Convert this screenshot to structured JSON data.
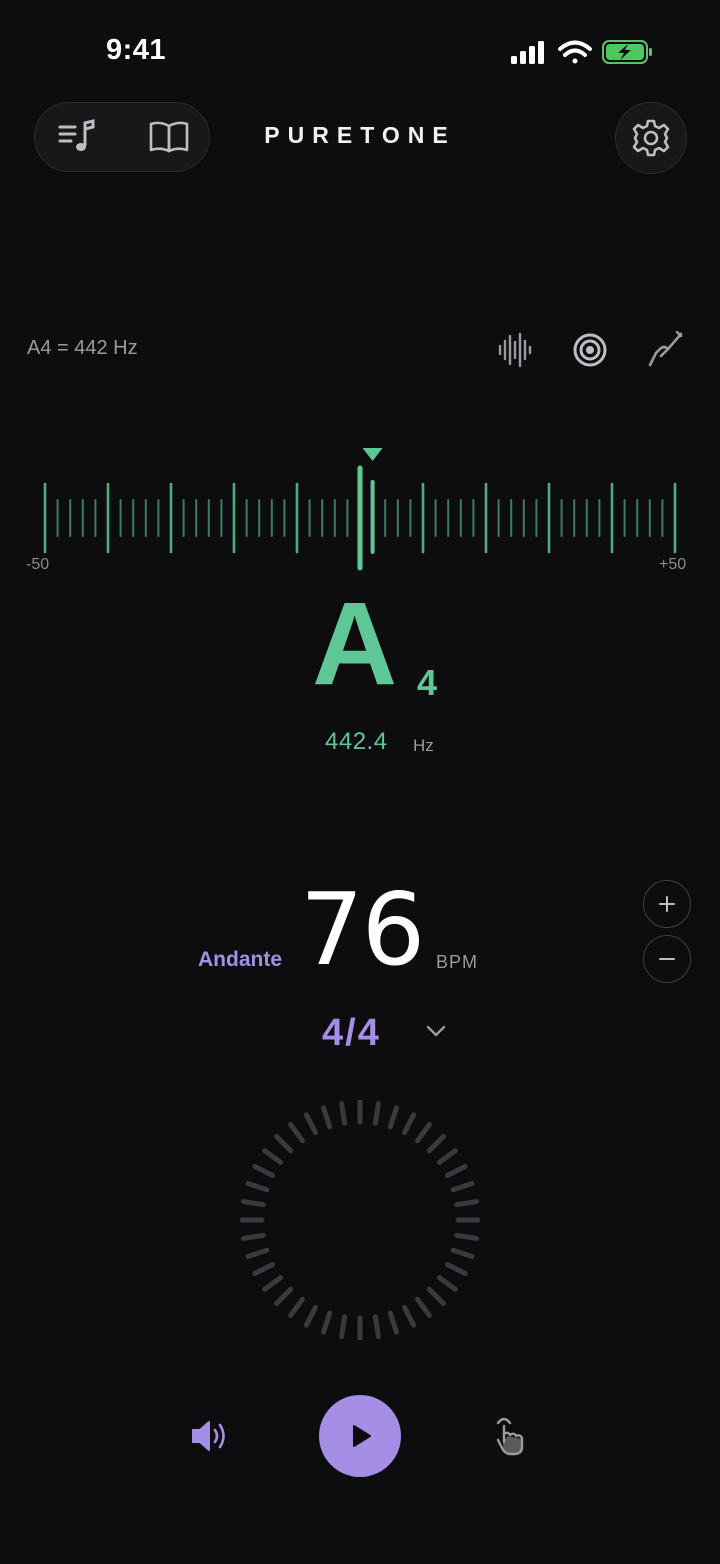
{
  "status_bar": {
    "time": "9:41"
  },
  "header": {
    "brand": "PURETONE",
    "left_buttons": [
      {
        "name": "playlist-icon"
      },
      {
        "name": "book-icon"
      }
    ],
    "right_button": {
      "name": "gear-icon"
    }
  },
  "tuner": {
    "reference": "A4 = 442 Hz",
    "tools": [
      {
        "name": "waveform-icon"
      },
      {
        "name": "target-icon"
      },
      {
        "name": "tuning-fork-icon"
      }
    ],
    "scale_min_label": "-50",
    "scale_max_label": "+50",
    "cents_offset": 1,
    "note": "A",
    "octave": "4",
    "frequency": "442.4",
    "frequency_unit": "Hz",
    "accent_color": "#5ec795"
  },
  "metronome": {
    "tempo_name": "Andante",
    "bpm": "76",
    "bpm_unit": "BPM",
    "increment_icon": "plus-icon",
    "decrement_icon": "minus-icon",
    "time_signature": "4/4",
    "accent_color": "#a58ee6"
  },
  "controls": {
    "volume_icon": "speaker-icon",
    "play_icon": "play-icon",
    "tap_icon": "tap-hand-icon"
  }
}
